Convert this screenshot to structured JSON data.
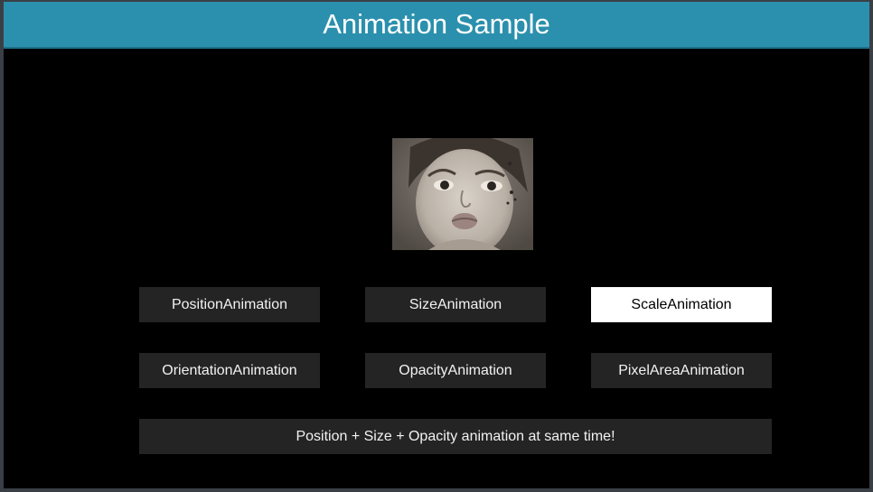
{
  "window": {
    "title": "Animation Sample"
  },
  "image": {
    "icon": "child-portrait-photo"
  },
  "buttons": {
    "position": "PositionAnimation",
    "size": "SizeAnimation",
    "scale": "ScaleAnimation",
    "orientation": "OrientationAnimation",
    "opacity": "OpacityAnimation",
    "pixel_area": "PixelAreaAnimation",
    "combined": "Position + Size + Opacity animation at same time!"
  },
  "state": {
    "selected_button": "ScaleAnimation"
  },
  "colors": {
    "title_bar": "#2b90ad",
    "background": "#000000",
    "button": "#242424",
    "button_selected": "#ffffff"
  }
}
